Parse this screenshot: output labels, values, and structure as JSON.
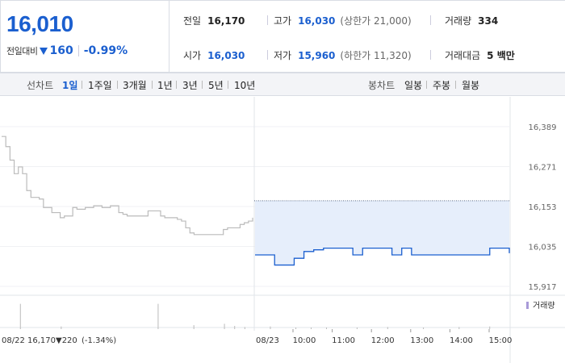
{
  "header": {
    "price": "16,010",
    "change_label": "전일대비",
    "change_value": "160",
    "change_pct": "-0.99%",
    "stats": {
      "prev_close": {
        "label": "전일",
        "value": "16,170"
      },
      "high": {
        "label": "고가",
        "value": "16,030",
        "sub": "(상한가 21,000)"
      },
      "volume": {
        "label": "거래량",
        "value": "334"
      },
      "open": {
        "label": "시가",
        "value": "16,030"
      },
      "low": {
        "label": "저가",
        "value": "15,960",
        "sub": "(하한가 11,320)"
      },
      "amount": {
        "label": "거래대금",
        "value": "5 백만"
      }
    }
  },
  "tabs": {
    "line_label": "선차트",
    "line_tabs": [
      "1일",
      "1주일",
      "3개월",
      "1년",
      "3년",
      "5년",
      "10년"
    ],
    "active_tab": 0,
    "candle_label": "봉차트",
    "candle_tabs": [
      "일봉",
      "주봉",
      "월봉"
    ]
  },
  "colors": {
    "accent": "#1b5fcf",
    "prev_day_line": "#bbbbbb",
    "fill": "#e6eefb",
    "volume_bar": "#bbbbbb"
  },
  "chart_data": {
    "type": "line",
    "y_ticks": [
      "16,389",
      "16,271",
      "16,153",
      "16,035",
      "15,917"
    ],
    "ylim": [
      15917,
      16389
    ],
    "reference_price": 16170,
    "prev_day": {
      "label": "08/22",
      "summary_price": "16,170",
      "summary_change": "▼220",
      "summary_pct": "(-1.34%)",
      "x": [
        0,
        1,
        2,
        3,
        4,
        5,
        6,
        7,
        8,
        9,
        10,
        11,
        12,
        13,
        14,
        15,
        16,
        17,
        18,
        19,
        20,
        21,
        22,
        23,
        24,
        25,
        26,
        27,
        28,
        29,
        30,
        31,
        32,
        33,
        34,
        35,
        36,
        37,
        38,
        39,
        40,
        41,
        42,
        43,
        44,
        45,
        46,
        47,
        48,
        49,
        50,
        51,
        52,
        53,
        54,
        55,
        56,
        57,
        58,
        59,
        60
      ],
      "values": [
        16360,
        16330,
        16290,
        16250,
        16270,
        16250,
        16200,
        16180,
        16180,
        16175,
        16150,
        16150,
        16135,
        16135,
        16120,
        16125,
        16125,
        16150,
        16145,
        16145,
        16150,
        16150,
        16155,
        16155,
        16150,
        16150,
        16155,
        16155,
        16135,
        16130,
        16125,
        16125,
        16125,
        16125,
        16125,
        16140,
        16140,
        16140,
        16125,
        16120,
        16120,
        16120,
        16115,
        16110,
        16090,
        16075,
        16070,
        16070,
        16070,
        16070,
        16070,
        16070,
        16070,
        16085,
        16090,
        16090,
        16090,
        16100,
        16105,
        16110,
        16120
      ]
    },
    "today": {
      "label": "08/23",
      "time_ticks": [
        "10:00",
        "11:00",
        "12:00",
        "13:00",
        "14:00",
        "15:00"
      ],
      "x": [
        0,
        1,
        2,
        3,
        4,
        5,
        6,
        7,
        8,
        9,
        10,
        11,
        12,
        13,
        14,
        15,
        16,
        17,
        18,
        19,
        20,
        21,
        22,
        23,
        24,
        25,
        26
      ],
      "values": [
        16010,
        16010,
        15980,
        15980,
        16000,
        16020,
        16025,
        16030,
        16030,
        16030,
        16010,
        16030,
        16030,
        16030,
        16010,
        16030,
        16010,
        16010,
        16010,
        16010,
        16010,
        16010,
        16010,
        16010,
        16030,
        16030,
        16015
      ]
    },
    "volume": {
      "label": "거래량",
      "bars": [
        {
          "pos": 0.04,
          "h": 0.95
        },
        {
          "pos": 0.12,
          "h": 0.1
        },
        {
          "pos": 0.31,
          "h": 0.95
        },
        {
          "pos": 0.38,
          "h": 0.15
        },
        {
          "pos": 0.44,
          "h": 0.2
        },
        {
          "pos": 0.46,
          "h": 0.12
        },
        {
          "pos": 0.48,
          "h": 0.08
        },
        {
          "pos": 0.53,
          "h": 0.1
        },
        {
          "pos": 0.58,
          "h": 0.06
        },
        {
          "pos": 0.61,
          "h": 0.06
        },
        {
          "pos": 0.64,
          "h": 0.06
        },
        {
          "pos": 0.7,
          "h": 0.06
        },
        {
          "pos": 0.76,
          "h": 0.08
        },
        {
          "pos": 0.83,
          "h": 0.06
        },
        {
          "pos": 0.9,
          "h": 0.08
        },
        {
          "pos": 0.96,
          "h": 0.1
        }
      ]
    }
  }
}
